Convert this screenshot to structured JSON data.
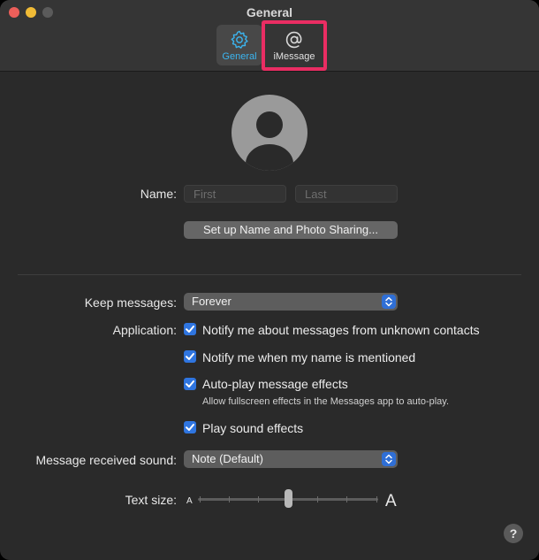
{
  "window": {
    "title": "General",
    "tabs": [
      {
        "label": "General",
        "icon": "gear-icon",
        "selected": true
      },
      {
        "label": "iMessage",
        "icon": "at-sign-icon",
        "selected": false
      }
    ],
    "highlight_color": "#ea2d63",
    "accent": "#3bb5f0"
  },
  "profile": {
    "name_label": "Name:",
    "first_placeholder": "First",
    "last_placeholder": "Last",
    "first_value": "",
    "last_value": "",
    "setup_button": "Set up Name and Photo Sharing..."
  },
  "keep_messages": {
    "label": "Keep messages:",
    "value": "Forever"
  },
  "application": {
    "label": "Application:",
    "options": [
      {
        "label": "Notify me about messages from unknown contacts",
        "checked": true
      },
      {
        "label": "Notify me when my name is mentioned",
        "checked": true
      },
      {
        "label": "Auto-play message effects",
        "checked": true
      },
      {
        "label": "Play sound effects",
        "checked": true
      }
    ],
    "autoplay_note": "Allow fullscreen effects in the Messages app to auto-play."
  },
  "sound": {
    "label": "Message received sound:",
    "value": "Note (Default)"
  },
  "text_size": {
    "label": "Text size:",
    "small_glyph": "A",
    "large_glyph": "A",
    "level": 0.5
  },
  "help": {
    "glyph": "?"
  }
}
